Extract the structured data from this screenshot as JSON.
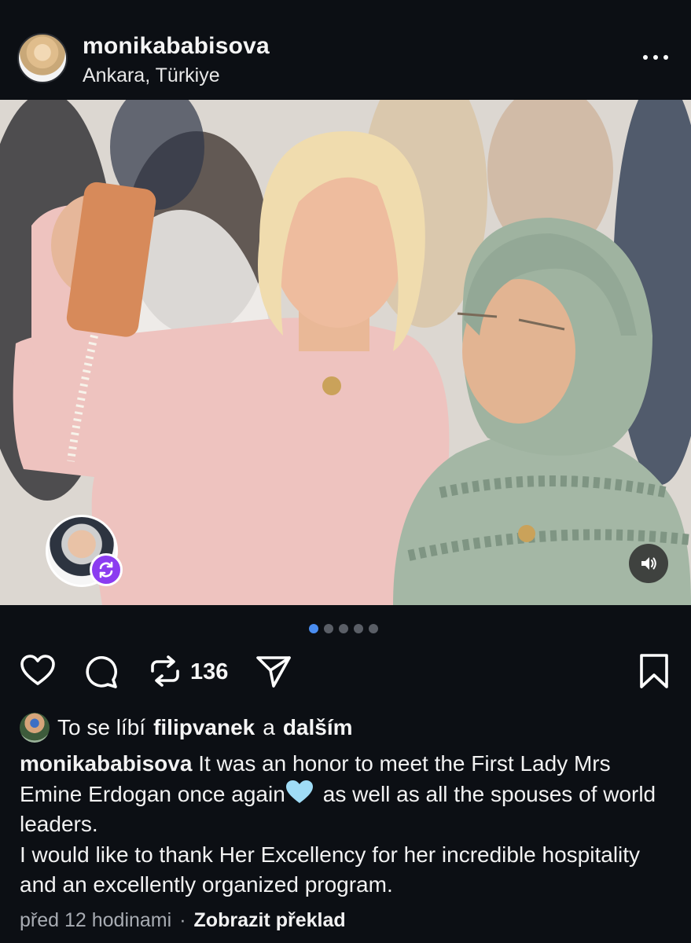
{
  "post": {
    "username": "monikababisova",
    "location": "Ankara, Türkiye",
    "more_label": "•••"
  },
  "media": {
    "carousel_count": 5,
    "active_index": 0
  },
  "actions": {
    "repost_count": "136"
  },
  "likes": {
    "prefix": "To se líbí",
    "user": "filipvanek",
    "joiner": "a",
    "others": "dalším"
  },
  "caption": {
    "author": "monikababisova",
    "line1_text": "It was an honor to meet the First Lady Mrs Emine Erdogan once again",
    "line1_after_emoji": "as well as all the spouses of world leaders.",
    "paragraph2": "I would like to thank Her Excellency for her incredible hospitality and an excellently organized program."
  },
  "meta": {
    "time": "před 12 hodinami",
    "separator": "·",
    "translate": "Zobrazit překlad"
  },
  "colors": {
    "background": "#0c0f14",
    "accent_dot": "#4a8df0",
    "repost_badge": "#8b3cf0"
  }
}
